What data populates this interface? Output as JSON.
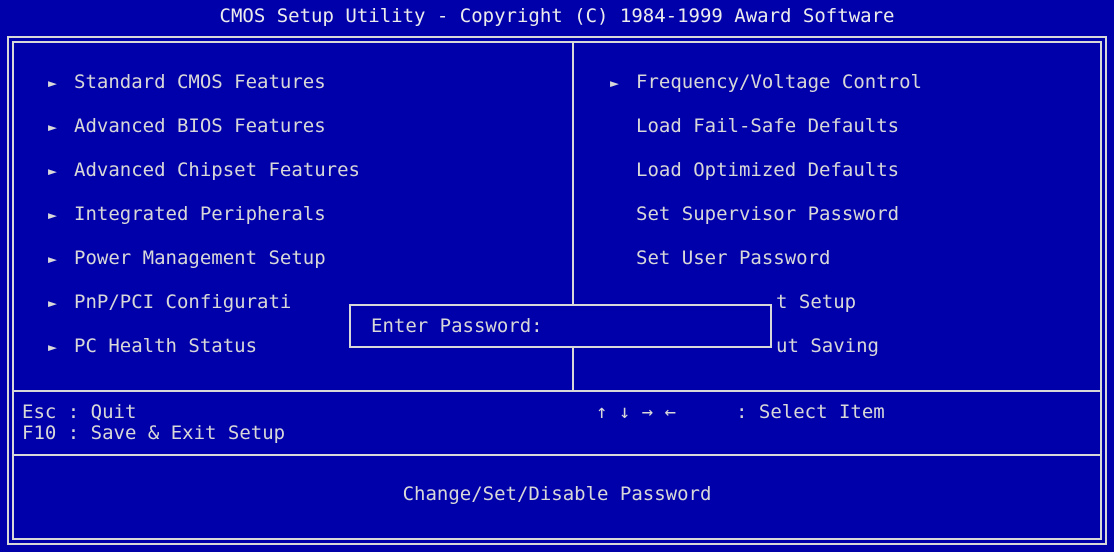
{
  "title": "CMOS Setup Utility - Copyright (C) 1984-1999 Award Software",
  "left_menu": [
    {
      "label": "Standard CMOS Features",
      "submenu": true
    },
    {
      "label": "Advanced BIOS Features",
      "submenu": true
    },
    {
      "label": "Advanced Chipset Features",
      "submenu": true
    },
    {
      "label": "Integrated Peripherals",
      "submenu": true
    },
    {
      "label": "Power Management Setup",
      "submenu": true
    },
    {
      "label": "PnP/PCI Configurati",
      "submenu": true
    },
    {
      "label": "PC Health Status",
      "submenu": true
    }
  ],
  "right_menu": [
    {
      "label": "Frequency/Voltage Control",
      "submenu": true
    },
    {
      "label": "Load Fail-Safe Defaults",
      "submenu": false
    },
    {
      "label": "Load Optimized Defaults",
      "submenu": false
    },
    {
      "label": "Set Supervisor Password",
      "submenu": false
    },
    {
      "label": "Set User Password",
      "submenu": false
    },
    {
      "label": "t Setup",
      "submenu": false
    },
    {
      "label": "ut Saving",
      "submenu": false
    }
  ],
  "password_dialog": {
    "label": "Enter Password:",
    "value": ""
  },
  "help": {
    "esc": "Esc : Quit",
    "f10": "F10 : Save & Exit Setup",
    "nav_keys": "↑ ↓ → ←",
    "select": ": Select Item"
  },
  "status_line": "Change/Set/Disable Password",
  "colors": {
    "background": "#0000aa",
    "foreground": "#d8d8d8"
  },
  "icons": {
    "submenu_marker": "submenu-arrow-icon"
  }
}
